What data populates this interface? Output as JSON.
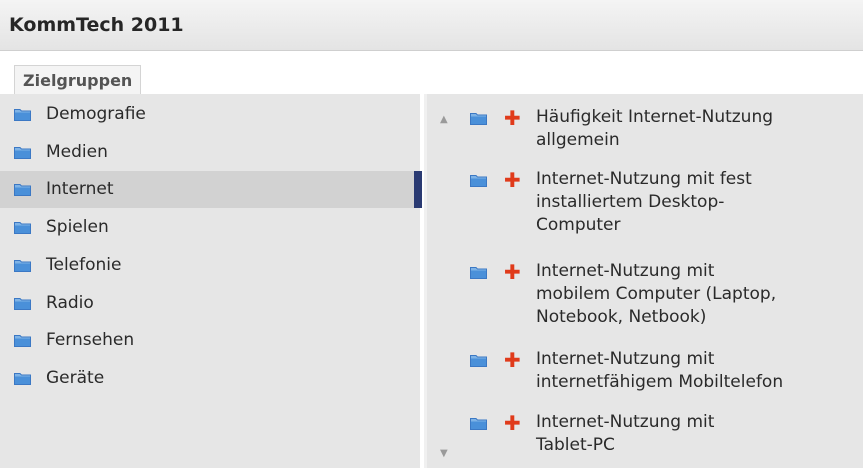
{
  "app": {
    "title": "KommTech 2011"
  },
  "tab": {
    "label": "Zielgruppen"
  },
  "categories": [
    {
      "label": "Demografie"
    },
    {
      "label": "Medien"
    },
    {
      "label": "Internet",
      "selected": true
    },
    {
      "label": "Spielen"
    },
    {
      "label": "Telefonie"
    },
    {
      "label": "Radio"
    },
    {
      "label": "Fernsehen"
    },
    {
      "label": "Geräte"
    }
  ],
  "subitems": [
    {
      "label": "Häufigkeit Internet-Nutzung\nallgemein"
    },
    {
      "label": "Internet-Nutzung mit fest\ninstalliertem Desktop-\nComputer"
    },
    {
      "label": "Internet-Nutzung mit\nmobilem Computer (Laptop,\nNotebook, Netbook)"
    },
    {
      "label": "Internet-Nutzung mit\ninternetfähigem Mobiltelefon"
    },
    {
      "label": "Internet-Nutzung mit\nTablet-PC"
    }
  ],
  "icons": {
    "folder": "folder-icon",
    "expand": "plus-icon",
    "scroll_up": "scroll-up-arrow-icon",
    "scroll_down": "scroll-down-arrow-icon"
  },
  "colors": {
    "selection_bar": "#2a3a72",
    "plus": "#e03a1a",
    "folder_blue": "#4a90d9"
  }
}
